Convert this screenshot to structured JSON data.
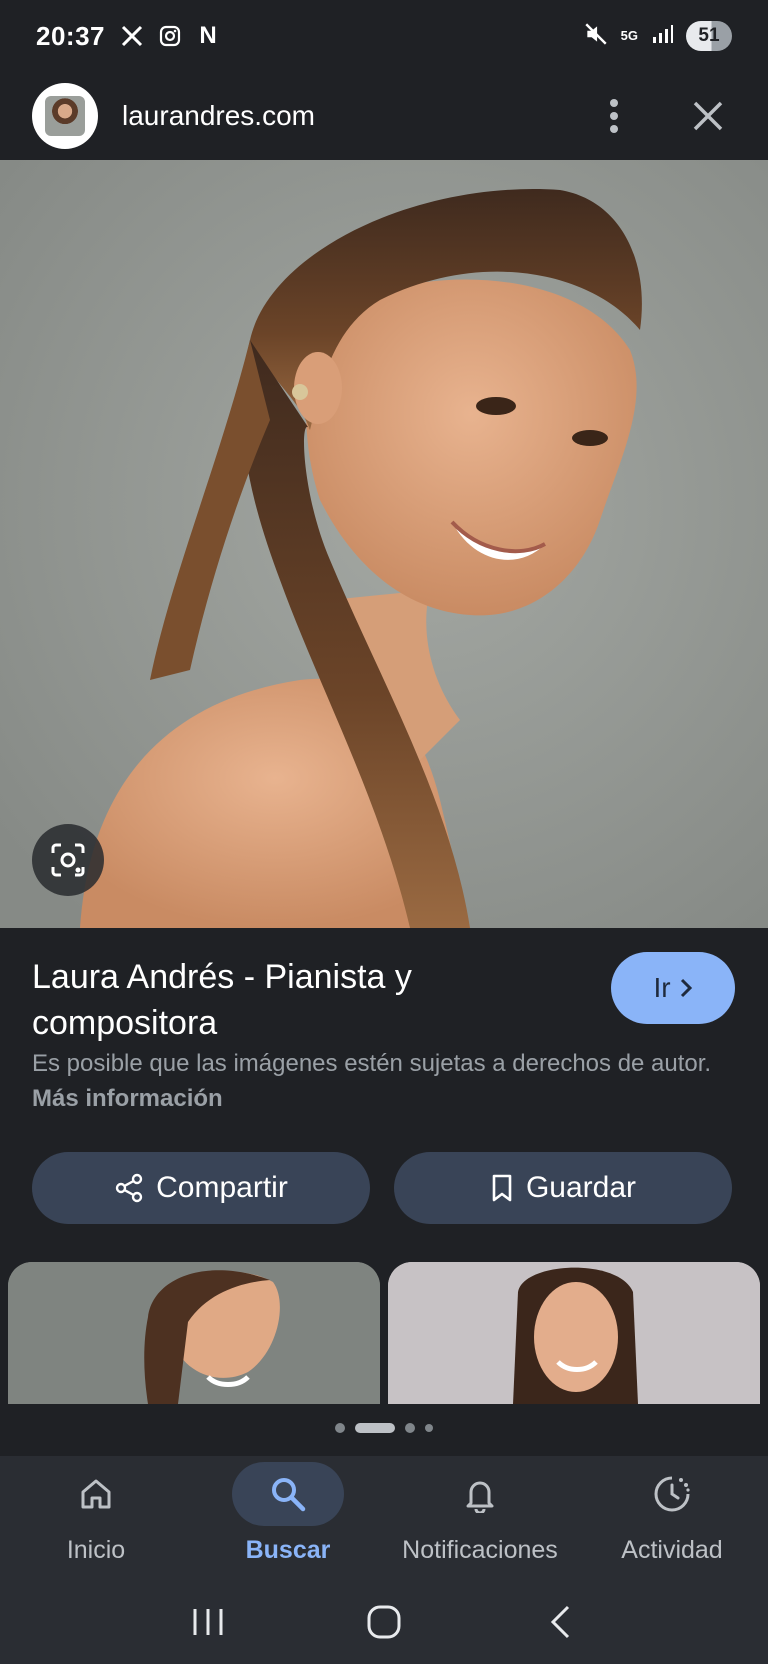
{
  "status_bar": {
    "time": "20:37",
    "left_icons": [
      "x-icon",
      "instagram-icon",
      "netflix-icon"
    ],
    "netflix_letter": "N",
    "network": "5G",
    "battery": "51"
  },
  "header": {
    "domain": "laurandres.com"
  },
  "result": {
    "title": "Laura Andrés - Pianista y compositora",
    "go_label": "Ir",
    "copyright_text": "Es posible que las imágenes estén sujetas a derechos de autor.",
    "more_info": "Más información",
    "share_label": "Compartir",
    "save_label": "Guardar"
  },
  "pager": {
    "count": 4,
    "active_index": 1
  },
  "bottom_nav": [
    {
      "label": "Inicio",
      "icon": "home-icon",
      "active": false
    },
    {
      "label": "Buscar",
      "icon": "search-icon",
      "active": true
    },
    {
      "label": "Notificaciones",
      "icon": "bell-icon",
      "active": false
    },
    {
      "label": "Actividad",
      "icon": "activity-icon",
      "active": false
    }
  ],
  "colors": {
    "background": "#1f2125",
    "accent": "#8ab4f8",
    "button": "#394457",
    "nav_bar": "#2a2d33"
  }
}
